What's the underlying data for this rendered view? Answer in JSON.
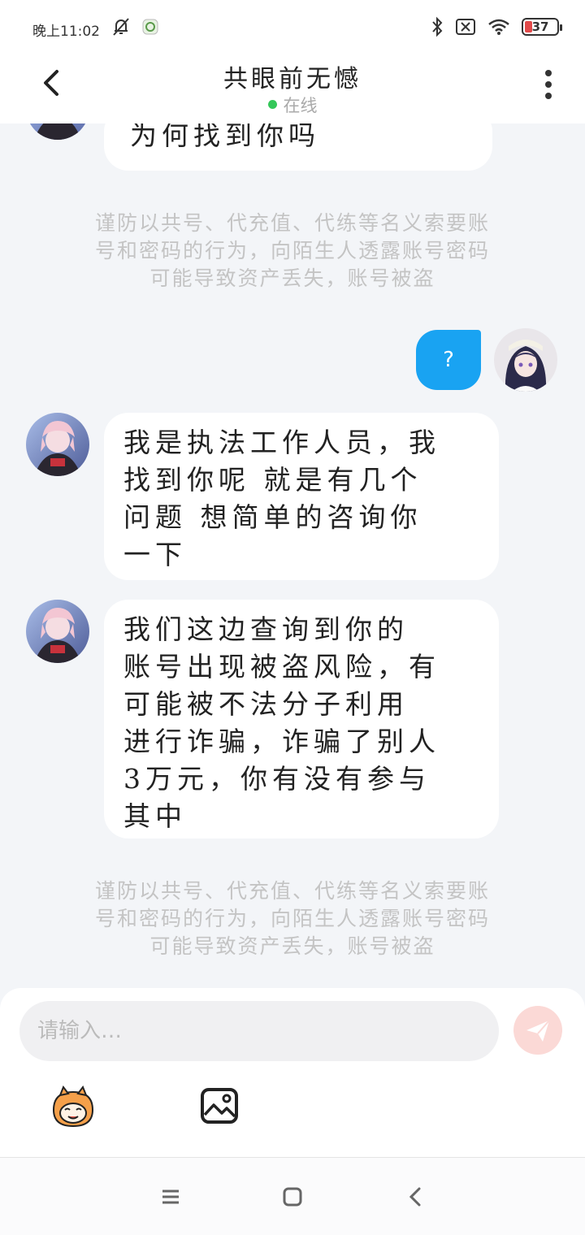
{
  "status_bar": {
    "time": "晚上11:02",
    "battery": "37"
  },
  "header": {
    "title": "共眼前无憾",
    "status": "在线"
  },
  "messages": [
    {
      "sender": "other",
      "text": "为何找到你吗"
    },
    {
      "sender": "system",
      "text": "谨防以共号、代充值、代练等名义索要账号和密码的行为，向陌生人透露账号密码可能导致资产丢失，账号被盗"
    },
    {
      "sender": "me",
      "text": "?"
    },
    {
      "sender": "other",
      "lines": [
        "我是执法工作人员，我",
        "找到你呢 就是有几个",
        "问题 想简单的咨询你",
        "一下"
      ]
    },
    {
      "sender": "other",
      "lines": [
        "我们这边查询到你的",
        "账号出现被盗风险，有",
        "可能被不法分子利用",
        "进行诈骗，诈骗了别人",
        "3万元，你有没有参与",
        "其中"
      ]
    },
    {
      "sender": "system",
      "text": "谨防以共号、代充值、代练等名义索要账号和密码的行为，向陌生人透露账号密码可能导致资产丢失，账号被盗"
    }
  ],
  "notice_lines": [
    "谨防以共号、代充值、代练等名义索要账",
    "号和密码的行为，向陌生人透露账号密码",
    "可能导致资产丢失，账号被盗"
  ],
  "input": {
    "placeholder": "请输入…"
  },
  "colors": {
    "accent_blue": "#19a3f2",
    "online_green": "#34c759",
    "send_button": "#fbd9d6",
    "background": "#f3f5f8"
  },
  "icons": [
    "back-icon",
    "more-icon",
    "send-icon",
    "emoji-icon",
    "image-icon",
    "menu-icon",
    "home-icon",
    "back-nav-icon"
  ]
}
